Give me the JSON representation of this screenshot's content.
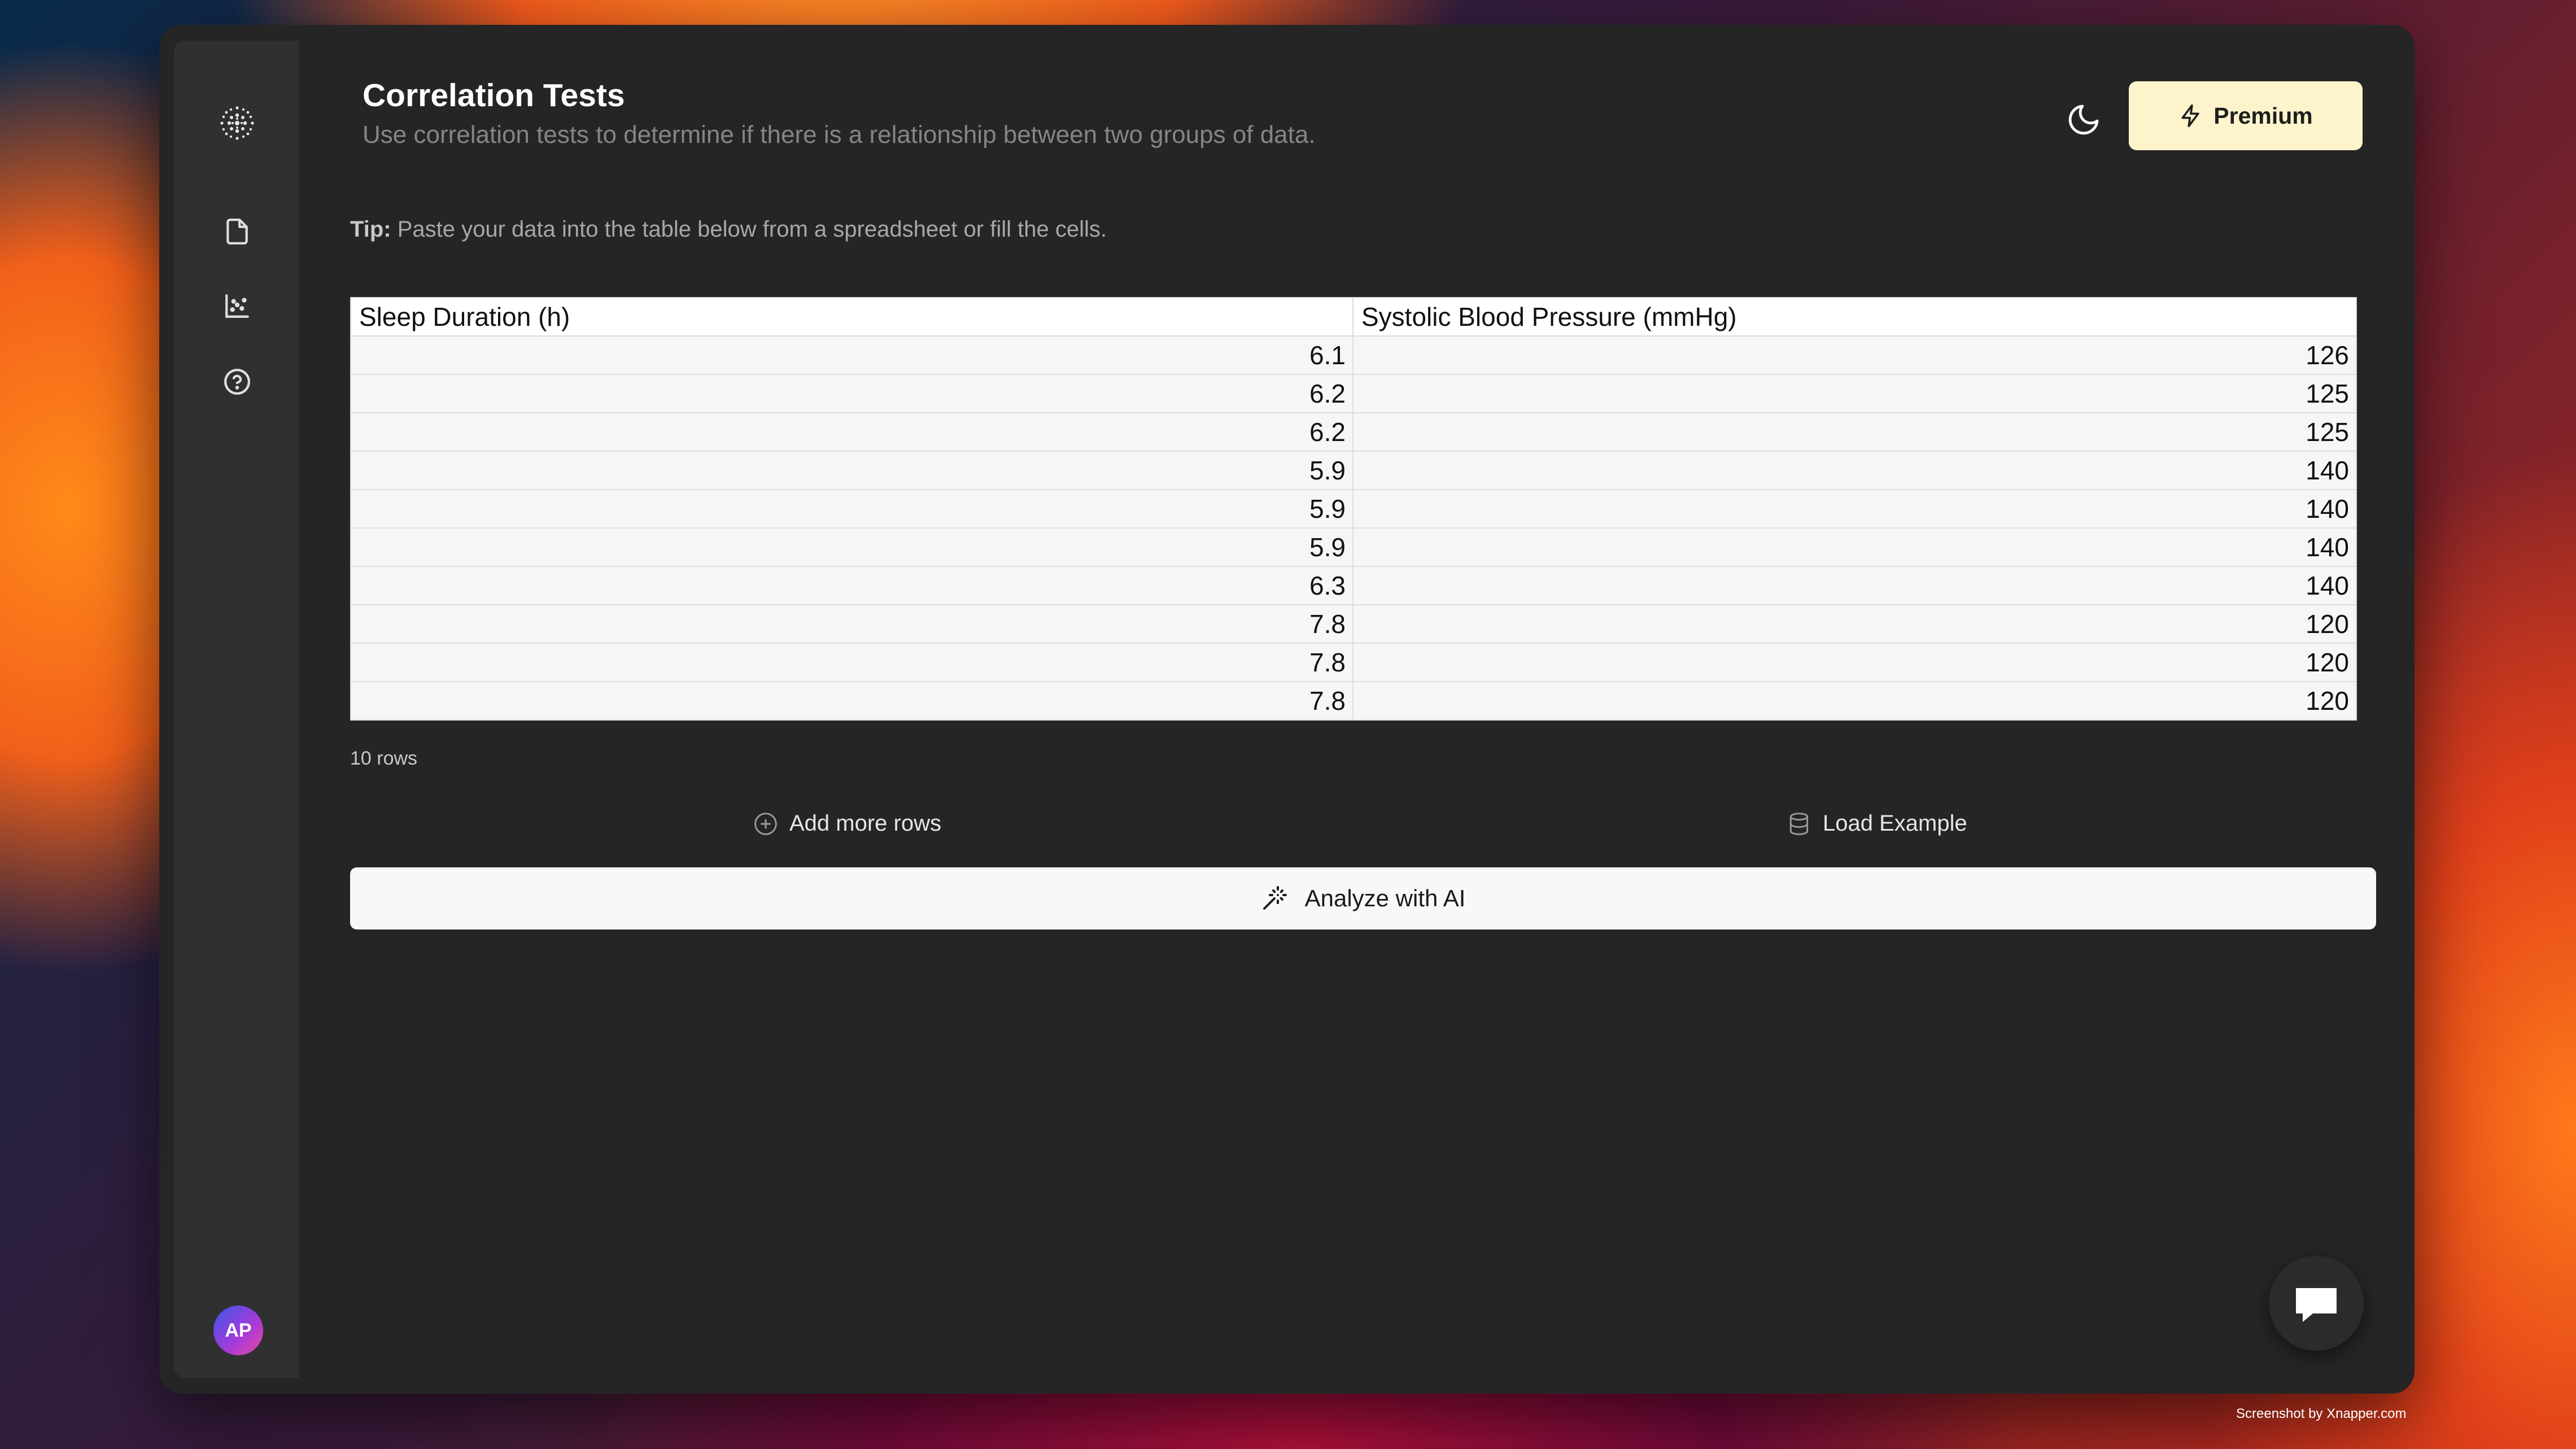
{
  "page": {
    "title": "Correlation Tests",
    "subtitle": "Use correlation tests to determine if there is a relationship between two groups of data."
  },
  "sidebar": {
    "items": [
      {
        "icon": "logo-icon"
      },
      {
        "icon": "file-icon"
      },
      {
        "icon": "scatter-chart-icon"
      },
      {
        "icon": "help-icon"
      }
    ],
    "avatar_initials": "AP"
  },
  "header": {
    "theme_icon": "moon-icon",
    "premium_label": "Premium",
    "premium_icon": "lightning-icon"
  },
  "tip": {
    "label": "Tip:",
    "text": "Paste your data into the table below from a spreadsheet or fill the cells."
  },
  "table": {
    "columns": [
      "Sleep Duration (h)",
      "Systolic Blood Pressure (mmHg)"
    ],
    "rows": [
      [
        "6.1",
        "126"
      ],
      [
        "6.2",
        "125"
      ],
      [
        "6.2",
        "125"
      ],
      [
        "5.9",
        "140"
      ],
      [
        "5.9",
        "140"
      ],
      [
        "5.9",
        "140"
      ],
      [
        "6.3",
        "140"
      ],
      [
        "7.8",
        "120"
      ],
      [
        "7.8",
        "120"
      ],
      [
        "7.8",
        "120"
      ]
    ],
    "row_count_label": "10 rows"
  },
  "actions": {
    "add_rows_label": "Add more rows",
    "load_example_label": "Load Example",
    "analyze_label": "Analyze with AI"
  },
  "chat_icon": "chat-bubble-icon",
  "credit": "Screenshot by Xnapper.com",
  "colors": {
    "window_bg": "#252525",
    "sidebar_bg": "#303030",
    "premium_bg": "#fdf4cc",
    "analyze_bg": "#f7f8fa"
  }
}
